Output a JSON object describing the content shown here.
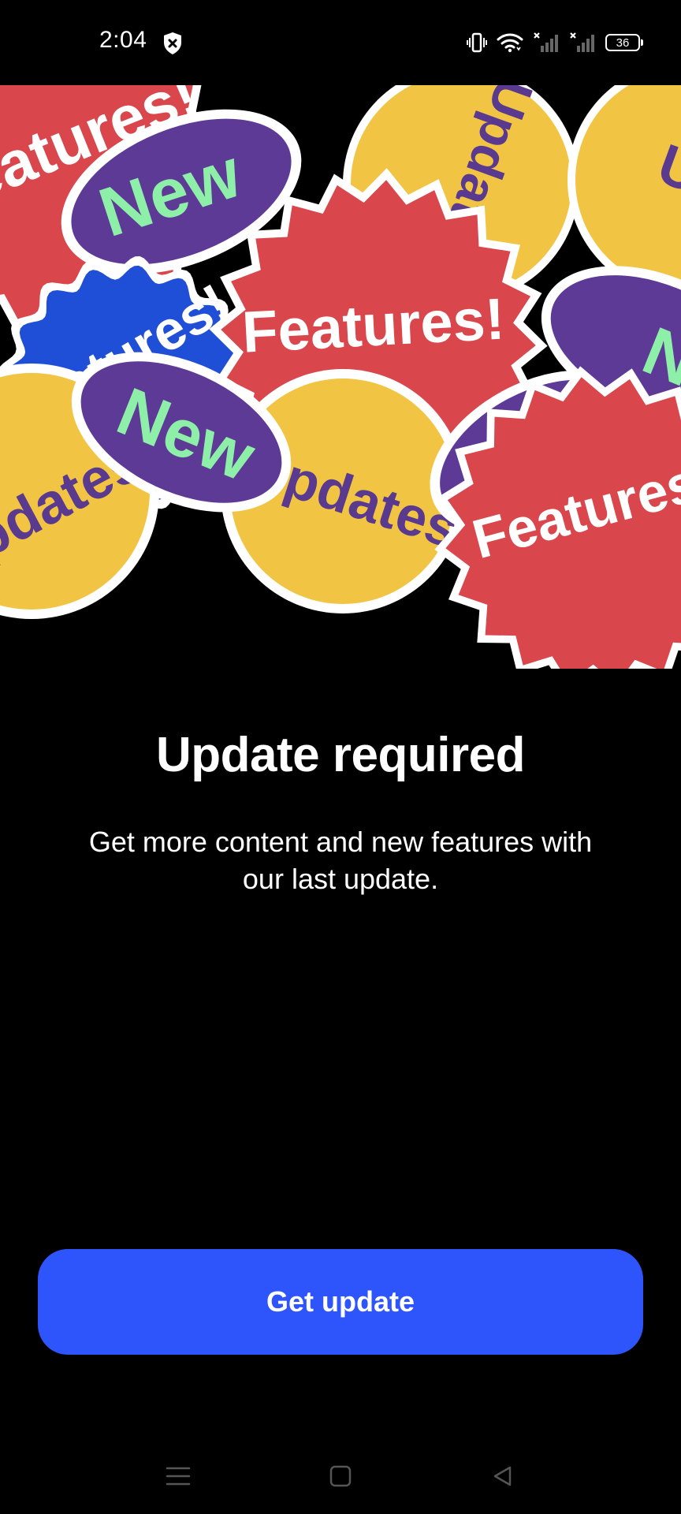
{
  "status_bar": {
    "time": "2:04",
    "battery_level": "36",
    "icons": [
      "shield-x-icon",
      "vibrate-icon",
      "wifi-icon",
      "signal-no-service-icon",
      "signal-no-service-icon",
      "battery-icon"
    ]
  },
  "hero": {
    "stickers": {
      "features": "Features!",
      "new": "New",
      "updates": "Updates"
    },
    "colors": {
      "red": "#d9474d",
      "yellow": "#f2c444",
      "purple": "#5d3a96",
      "blue": "#1f4fd6",
      "green_text": "#8ef0a8",
      "purple_text": "#5a3a8e"
    }
  },
  "content": {
    "title": "Update required",
    "subtitle": "Get more content and new features with our last update."
  },
  "actions": {
    "get_update_label": "Get update",
    "accent_color": "#2d55fb"
  },
  "nav_bar": {
    "items": [
      "menu-icon",
      "home-icon",
      "back-icon"
    ]
  }
}
